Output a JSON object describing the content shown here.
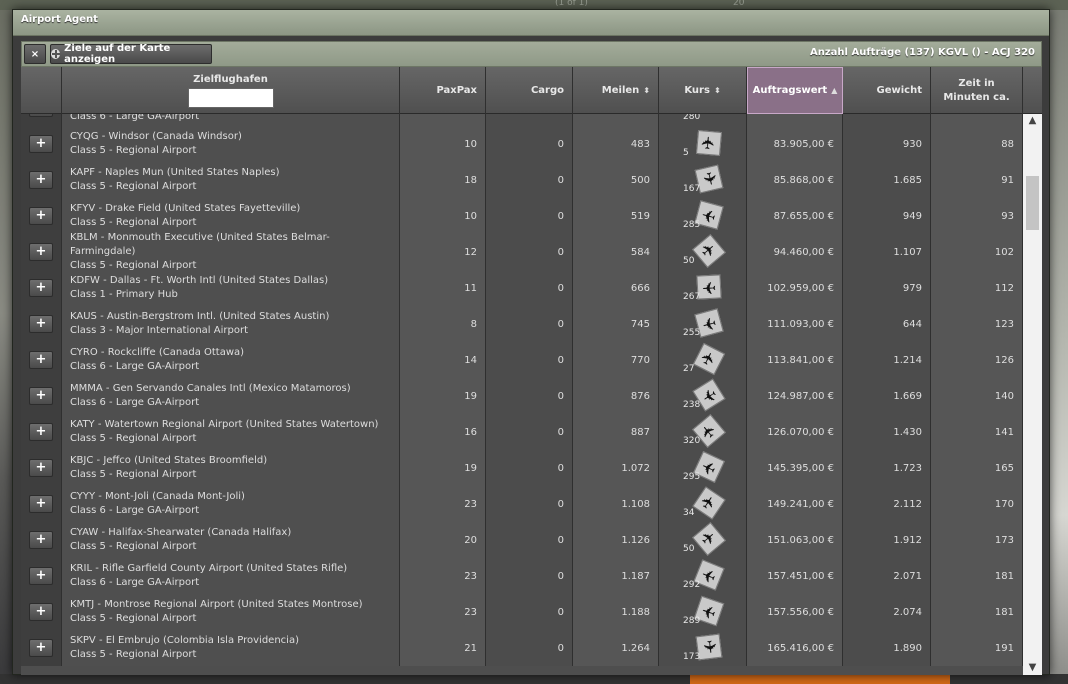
{
  "background": {
    "pager": "(1 of 1)",
    "page_size": "20"
  },
  "window": {
    "title": "Airport Agent"
  },
  "toolbar": {
    "close_label": "×",
    "map_label": "Ziele auf der Karte anzeigen",
    "info": "Anzahl Aufträge (137) KGVL () - ACJ 320"
  },
  "columns": {
    "ziel": "Zielflughafen",
    "pax": "PaxPax",
    "cargo": "Cargo",
    "meilen": "Meilen",
    "kurs": "Kurs",
    "auftragswert": "Auftragswert",
    "gewicht": "Gewicht",
    "zeit": "Zeit in Minuten ca."
  },
  "search": {
    "value": ""
  },
  "partial_row": {
    "class": "Class 6 - Large GA-Airport",
    "kurs": "280"
  },
  "rows": [
    {
      "code": "CYQG - Windsor (Canada Windsor)",
      "class": "Class 5 - Regional Airport",
      "pax": "10",
      "cargo": "0",
      "meilen": "483",
      "kurs": "5",
      "wert": "83.905,00 €",
      "gewicht": "930",
      "zeit": "88"
    },
    {
      "code": "KAPF - Naples Mun (United States Naples)",
      "class": "Class 5 - Regional Airport",
      "pax": "18",
      "cargo": "0",
      "meilen": "500",
      "kurs": "167",
      "wert": "85.868,00 €",
      "gewicht": "1.685",
      "zeit": "91"
    },
    {
      "code": "KFYV - Drake Field (United States Fayetteville)",
      "class": "Class 5 - Regional Airport",
      "pax": "10",
      "cargo": "0",
      "meilen": "519",
      "kurs": "285",
      "wert": "87.655,00 €",
      "gewicht": "949",
      "zeit": "93"
    },
    {
      "code": "KBLM - Monmouth Executive (United States Belmar-Farmingdale)",
      "class": "Class 5 - Regional Airport",
      "pax": "12",
      "cargo": "0",
      "meilen": "584",
      "kurs": "50",
      "wert": "94.460,00 €",
      "gewicht": "1.107",
      "zeit": "102"
    },
    {
      "code": "KDFW - Dallas - Ft. Worth Intl (United States Dallas)",
      "class": "Class 1 - Primary Hub",
      "pax": "11",
      "cargo": "0",
      "meilen": "666",
      "kurs": "267",
      "wert": "102.959,00 €",
      "gewicht": "979",
      "zeit": "112"
    },
    {
      "code": "KAUS - Austin-Bergstrom Intl. (United States Austin)",
      "class": "Class 3 - Major International Airport",
      "pax": "8",
      "cargo": "0",
      "meilen": "745",
      "kurs": "255",
      "wert": "111.093,00 €",
      "gewicht": "644",
      "zeit": "123"
    },
    {
      "code": "CYRO - Rockcliffe (Canada Ottawa)",
      "class": "Class 6 - Large GA-Airport",
      "pax": "14",
      "cargo": "0",
      "meilen": "770",
      "kurs": "27",
      "wert": "113.841,00 €",
      "gewicht": "1.214",
      "zeit": "126"
    },
    {
      "code": "MMMA - Gen Servando Canales Intl (Mexico Matamoros)",
      "class": "Class 6 - Large GA-Airport",
      "pax": "19",
      "cargo": "0",
      "meilen": "876",
      "kurs": "238",
      "wert": "124.987,00 €",
      "gewicht": "1.669",
      "zeit": "140"
    },
    {
      "code": "KATY - Watertown Regional Airport (United States Watertown)",
      "class": "Class 5 - Regional Airport",
      "pax": "16",
      "cargo": "0",
      "meilen": "887",
      "kurs": "320",
      "wert": "126.070,00 €",
      "gewicht": "1.430",
      "zeit": "141"
    },
    {
      "code": "KBJC - Jeffco (United States Broomfield)",
      "class": "Class 5 - Regional Airport",
      "pax": "19",
      "cargo": "0",
      "meilen": "1.072",
      "kurs": "295",
      "wert": "145.395,00 €",
      "gewicht": "1.723",
      "zeit": "165"
    },
    {
      "code": "CYYY - Mont-Joli (Canada Mont-Joli)",
      "class": "Class 6 - Large GA-Airport",
      "pax": "23",
      "cargo": "0",
      "meilen": "1.108",
      "kurs": "34",
      "wert": "149.241,00 €",
      "gewicht": "2.112",
      "zeit": "170"
    },
    {
      "code": "CYAW - Halifax-Shearwater (Canada Halifax)",
      "class": "Class 5 - Regional Airport",
      "pax": "20",
      "cargo": "0",
      "meilen": "1.126",
      "kurs": "50",
      "wert": "151.063,00 €",
      "gewicht": "1.912",
      "zeit": "173"
    },
    {
      "code": "KRIL - Rifle Garfield County Airport (United States Rifle)",
      "class": "Class 6 - Large GA-Airport",
      "pax": "23",
      "cargo": "0",
      "meilen": "1.187",
      "kurs": "292",
      "wert": "157.451,00 €",
      "gewicht": "2.071",
      "zeit": "181"
    },
    {
      "code": "KMTJ - Montrose Regional Airport (United States Montrose)",
      "class": "Class 5 - Regional Airport",
      "pax": "23",
      "cargo": "0",
      "meilen": "1.188",
      "kurs": "289",
      "wert": "157.556,00 €",
      "gewicht": "2.074",
      "zeit": "181"
    },
    {
      "code": "SKPV - El Embrujo (Colombia Isla Providencia)",
      "class": "Class 5 - Regional Airport",
      "pax": "21",
      "cargo": "0",
      "meilen": "1.264",
      "kurs": "173",
      "wert": "165.416,00 €",
      "gewicht": "1.890",
      "zeit": "191"
    }
  ]
}
